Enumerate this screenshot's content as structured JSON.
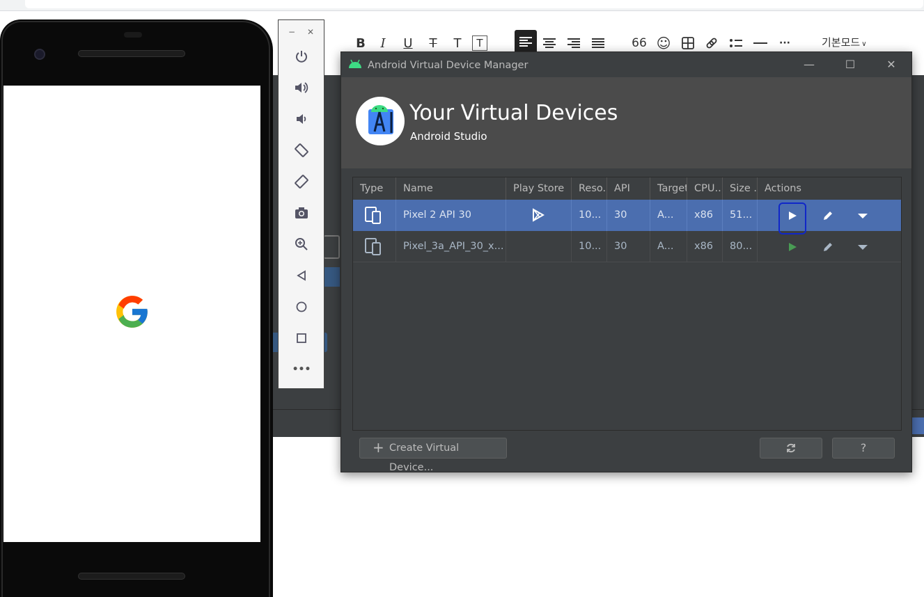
{
  "editor": {
    "toolbar": {
      "bold": "B",
      "italic": "I",
      "underline": "U",
      "strike": "T",
      "text_color": "T",
      "text_bg": "T",
      "quote": "66",
      "more": "···",
      "mode": "기본모드"
    }
  },
  "avd": {
    "window_title": "Android Virtual Device Manager",
    "heading": "Your Virtual Devices",
    "subheading": "Android Studio",
    "columns": [
      "Type",
      "Name",
      "Play Store",
      "Reso...",
      "API",
      "Target",
      "CPU...",
      "Size ..",
      "Actions"
    ],
    "devices": [
      {
        "name": "Pixel 2 API 30",
        "play_store": true,
        "resolution": "10...",
        "api": "30",
        "target": "A...",
        "cpu": "x86",
        "size": "51...",
        "selected": true
      },
      {
        "name": "Pixel_3a_API_30_x...",
        "play_store": false,
        "resolution": "10...",
        "api": "30",
        "target": "A...",
        "cpu": "x86",
        "size": "80...",
        "selected": false
      }
    ],
    "create_button": "Create Virtual Device...",
    "help_button": "?"
  },
  "colors": {
    "accent_selected_row": "#4b6eaf",
    "window_bg": "#3c3f41",
    "header_bg": "#4b4b4b",
    "play_green": "#499c54",
    "annotation_blue": "#1027c8"
  }
}
